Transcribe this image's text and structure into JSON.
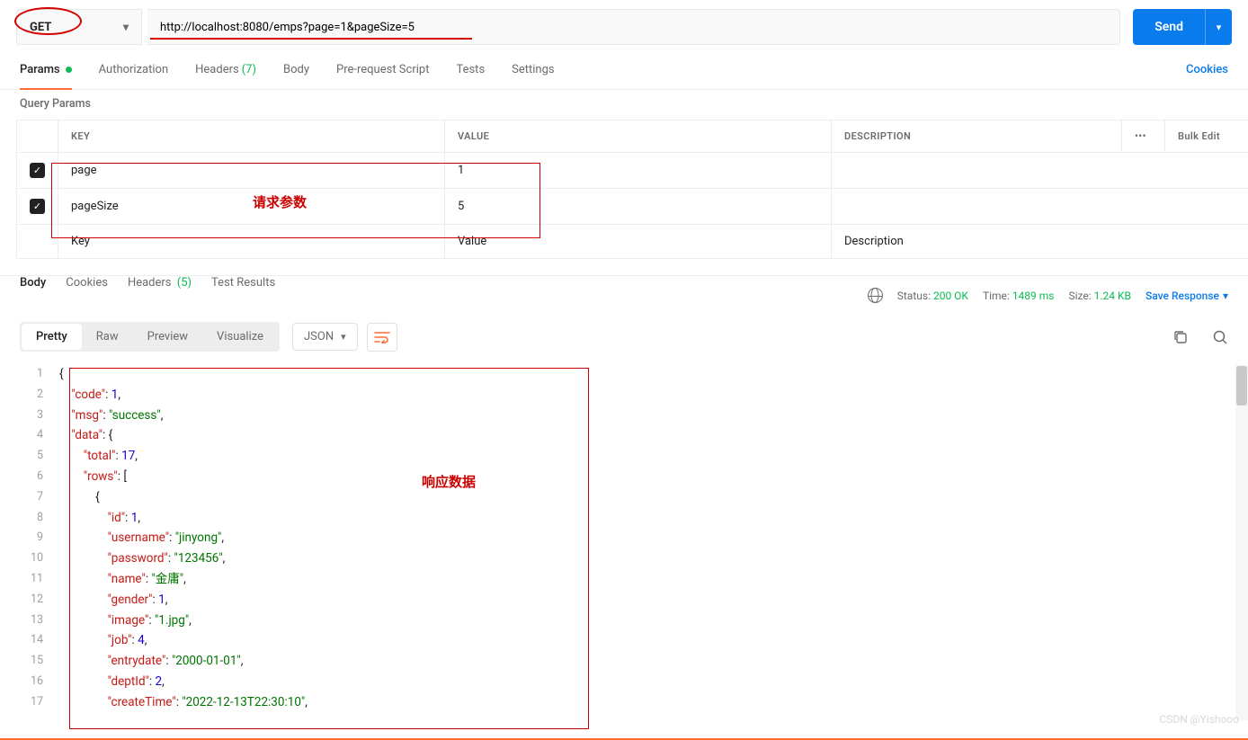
{
  "request": {
    "method": "GET",
    "url": "http://localhost:8080/emps?page=1&pageSize=5",
    "send_label": "Send"
  },
  "tabs": {
    "items": [
      {
        "label": "Params",
        "active": true,
        "dot": true
      },
      {
        "label": "Authorization"
      },
      {
        "label": "Headers",
        "count": "(7)"
      },
      {
        "label": "Body"
      },
      {
        "label": "Pre-request Script"
      },
      {
        "label": "Tests"
      },
      {
        "label": "Settings"
      }
    ],
    "cookies": "Cookies"
  },
  "params": {
    "section": "Query Params",
    "headers": {
      "key": "KEY",
      "value": "VALUE",
      "desc": "DESCRIPTION",
      "bulk": "Bulk Edit"
    },
    "rows": [
      {
        "checked": true,
        "key": "page",
        "value": "1",
        "desc": ""
      },
      {
        "checked": true,
        "key": "pageSize",
        "value": "5",
        "desc": ""
      }
    ],
    "placeholders": {
      "key": "Key",
      "value": "Value",
      "desc": "Description"
    }
  },
  "response": {
    "tabs": [
      {
        "label": "Body",
        "active": true
      },
      {
        "label": "Cookies"
      },
      {
        "label": "Headers",
        "count": "(5)"
      },
      {
        "label": "Test Results"
      }
    ],
    "status_label": "Status:",
    "status_value": "200 OK",
    "time_label": "Time:",
    "time_value": "1489 ms",
    "size_label": "Size:",
    "size_value": "1.24 KB",
    "save": "Save Response",
    "views": [
      "Pretty",
      "Raw",
      "Preview",
      "Visualize"
    ],
    "format": "JSON"
  },
  "code_lines": [
    {
      "n": 1,
      "c": [
        [
          "p",
          "{"
        ]
      ]
    },
    {
      "n": 2,
      "c": [
        [
          "p",
          "    "
        ],
        [
          "k",
          "\"code\""
        ],
        [
          "p",
          ": "
        ],
        [
          "n",
          "1"
        ],
        [
          "p",
          ","
        ]
      ]
    },
    {
      "n": 3,
      "c": [
        [
          "p",
          "    "
        ],
        [
          "k",
          "\"msg\""
        ],
        [
          "p",
          ": "
        ],
        [
          "s",
          "\"success\""
        ],
        [
          "p",
          ","
        ]
      ]
    },
    {
      "n": 4,
      "c": [
        [
          "p",
          "    "
        ],
        [
          "k",
          "\"data\""
        ],
        [
          "p",
          ": {"
        ]
      ]
    },
    {
      "n": 5,
      "c": [
        [
          "p",
          "        "
        ],
        [
          "k",
          "\"total\""
        ],
        [
          "p",
          ": "
        ],
        [
          "n",
          "17"
        ],
        [
          "p",
          ","
        ]
      ]
    },
    {
      "n": 6,
      "c": [
        [
          "p",
          "        "
        ],
        [
          "k",
          "\"rows\""
        ],
        [
          "p",
          ": ["
        ]
      ]
    },
    {
      "n": 7,
      "c": [
        [
          "p",
          "            {"
        ]
      ]
    },
    {
      "n": 8,
      "c": [
        [
          "p",
          "                "
        ],
        [
          "k",
          "\"id\""
        ],
        [
          "p",
          ": "
        ],
        [
          "n",
          "1"
        ],
        [
          "p",
          ","
        ]
      ]
    },
    {
      "n": 9,
      "c": [
        [
          "p",
          "                "
        ],
        [
          "k",
          "\"username\""
        ],
        [
          "p",
          ": "
        ],
        [
          "s",
          "\"jinyong\""
        ],
        [
          "p",
          ","
        ]
      ]
    },
    {
      "n": 10,
      "c": [
        [
          "p",
          "                "
        ],
        [
          "k",
          "\"password\""
        ],
        [
          "p",
          ": "
        ],
        [
          "s",
          "\"123456\""
        ],
        [
          "p",
          ","
        ]
      ]
    },
    {
      "n": 11,
      "c": [
        [
          "p",
          "                "
        ],
        [
          "k",
          "\"name\""
        ],
        [
          "p",
          ": "
        ],
        [
          "s",
          "\"金庸\""
        ],
        [
          "p",
          ","
        ]
      ]
    },
    {
      "n": 12,
      "c": [
        [
          "p",
          "                "
        ],
        [
          "k",
          "\"gender\""
        ],
        [
          "p",
          ": "
        ],
        [
          "n",
          "1"
        ],
        [
          "p",
          ","
        ]
      ]
    },
    {
      "n": 13,
      "c": [
        [
          "p",
          "                "
        ],
        [
          "k",
          "\"image\""
        ],
        [
          "p",
          ": "
        ],
        [
          "s",
          "\"1.jpg\""
        ],
        [
          "p",
          ","
        ]
      ]
    },
    {
      "n": 14,
      "c": [
        [
          "p",
          "                "
        ],
        [
          "k",
          "\"job\""
        ],
        [
          "p",
          ": "
        ],
        [
          "n",
          "4"
        ],
        [
          "p",
          ","
        ]
      ]
    },
    {
      "n": 15,
      "c": [
        [
          "p",
          "                "
        ],
        [
          "k",
          "\"entrydate\""
        ],
        [
          "p",
          ": "
        ],
        [
          "s",
          "\"2000-01-01\""
        ],
        [
          "p",
          ","
        ]
      ]
    },
    {
      "n": 16,
      "c": [
        [
          "p",
          "                "
        ],
        [
          "k",
          "\"deptId\""
        ],
        [
          "p",
          ": "
        ],
        [
          "n",
          "2"
        ],
        [
          "p",
          ","
        ]
      ]
    },
    {
      "n": 17,
      "c": [
        [
          "p",
          "                "
        ],
        [
          "k",
          "\"createTime\""
        ],
        [
          "p",
          ": "
        ],
        [
          "s",
          "\"2022-12-13T22:30:10\""
        ],
        [
          "p",
          ","
        ]
      ]
    }
  ],
  "annotations": {
    "req_params": "请求参数",
    "resp_data": "响应数据"
  },
  "watermark": "CSDN @Yishooo"
}
